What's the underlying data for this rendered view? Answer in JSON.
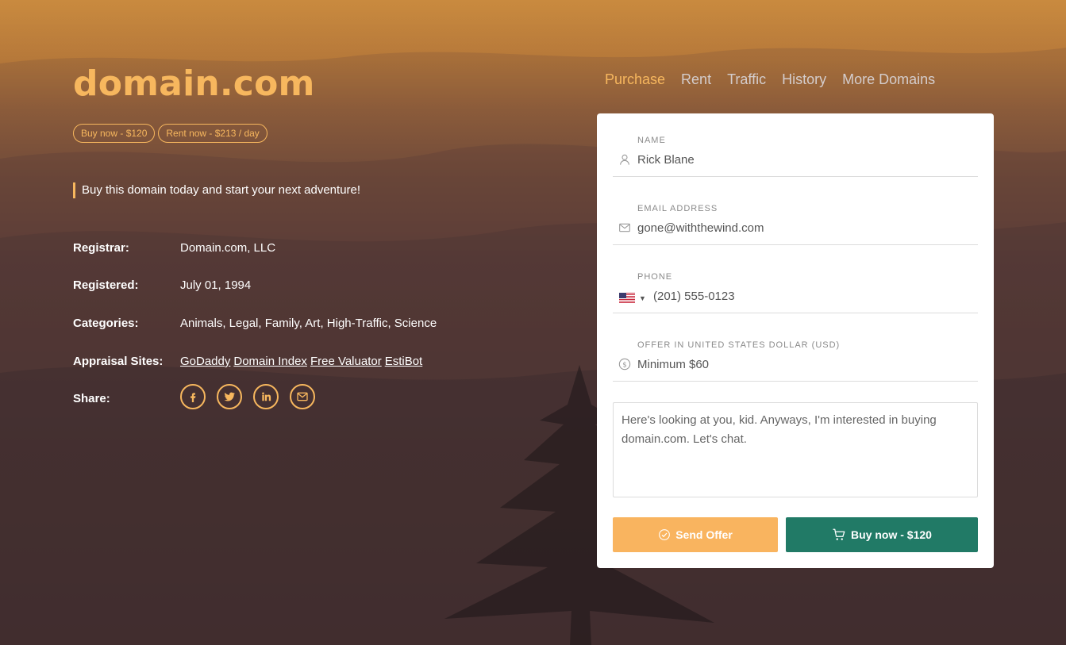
{
  "domain": {
    "title": "domain.com"
  },
  "pills": {
    "buy": "Buy now - $120",
    "rent": "Rent now - $213 / day"
  },
  "tagline": "Buy this domain today and start your next adventure!",
  "details": {
    "registrar": {
      "label": "Registrar:",
      "value": "Domain.com, LLC"
    },
    "registered": {
      "label": "Registered:",
      "value": "July 01, 1994"
    },
    "categories": {
      "label": "Categories:",
      "value": "Animals, Legal, Family, Art, High-Traffic, Science"
    },
    "appraisal": {
      "label": "Appraisal Sites:",
      "links": [
        "GoDaddy",
        "Domain Index",
        "Free Valuator",
        "EstiBot"
      ]
    },
    "share": {
      "label": "Share:",
      "icons": [
        "facebook-icon",
        "twitter-icon",
        "linkedin-icon",
        "email-icon"
      ]
    }
  },
  "nav": {
    "items": [
      "Purchase",
      "Rent",
      "Traffic",
      "History",
      "More Domains"
    ],
    "active": "Purchase"
  },
  "form": {
    "name": {
      "label": "NAME",
      "value": "Rick Blane",
      "icon": "user-icon"
    },
    "email": {
      "label": "EMAIL ADDRESS",
      "value": "gone@withthewind.com",
      "icon": "envelope-icon"
    },
    "phone": {
      "label": "PHONE",
      "value": "(201) 555-0123",
      "icon": "us-flag-icon"
    },
    "offer": {
      "label": "OFFER IN UNITED STATES DOLLAR (USD)",
      "placeholder": "Minimum $60",
      "icon": "dollar-icon"
    },
    "message": "Here's looking at you, kid. Anyways, I'm interested in buying domain.com. Let's chat.",
    "send_label": "Send Offer",
    "buy_label": "Buy now - $120"
  },
  "colors": {
    "accent": "#f7b75e",
    "offer_button": "#f9b45f",
    "buy_button": "#217a66"
  }
}
